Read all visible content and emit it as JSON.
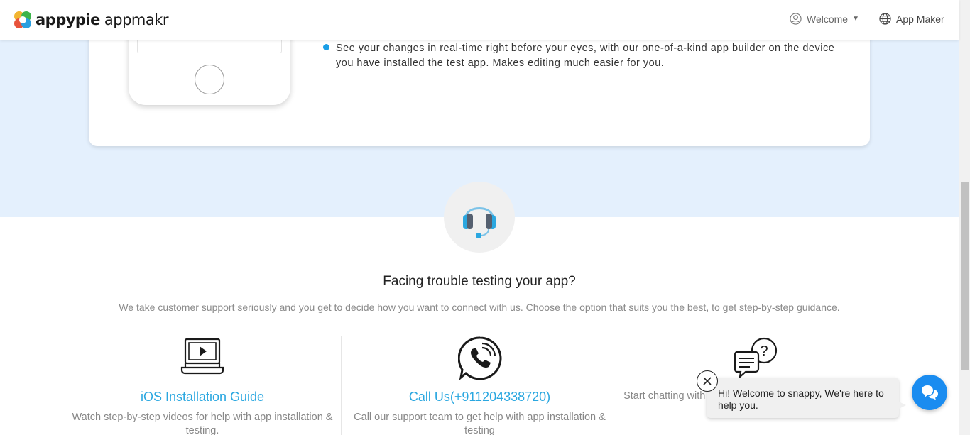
{
  "header": {
    "brand_bold": "appypie",
    "brand_light": "appmakr",
    "welcome_label": "Welcome",
    "app_maker_label": "App Maker"
  },
  "feature_card": {
    "bullet_text": "See your changes in real-time right before your eyes, with our one-of-a-kind app builder on the device you have installed the test app. Makes editing much easier for you."
  },
  "support": {
    "title": "Facing trouble testing your app?",
    "subtitle": "We take customer support seriously and you get to decide how you want to connect with us. Choose the option that suits you the best, to get step-by-step guidance.",
    "options": [
      {
        "icon": "video-laptop-icon",
        "title": "iOS Installation Guide",
        "description": "Watch step-by-step videos for help with app installation & testing."
      },
      {
        "icon": "phone-call-icon",
        "title": "Call Us(+911204338720)",
        "description": "Call our support team to get help with app installation & testing"
      },
      {
        "icon": "chat-question-icon",
        "title": "",
        "description": "Start chatting with our experts for help with app installation & testing."
      }
    ]
  },
  "chat_widget": {
    "message": "Hi! Welcome to snappy, We're here to help you."
  },
  "colors": {
    "accent_blue": "#2aa7e0",
    "band_blue": "#e4f0fd",
    "chat_blue": "#1a8cf0"
  }
}
